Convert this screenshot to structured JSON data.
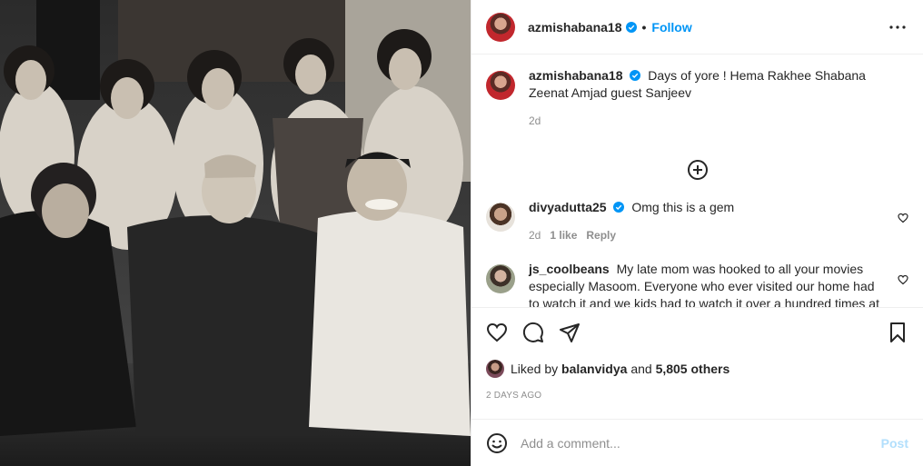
{
  "post": {
    "username": "azmishabana18",
    "follow_label": "Follow",
    "dot": "•",
    "caption": "Days of yore ! Hema Rakhee Shabana Zeenat Amjad guest Sanjeev",
    "caption_age": "2d"
  },
  "comments": [
    {
      "username": "divyadutta25",
      "text": "Omg this is a gem",
      "age": "2d",
      "likes": "1 like",
      "reply_label": "Reply"
    },
    {
      "username": "js_coolbeans",
      "text": "My late mom was hooked to all your movies especially Masoom. Everyone who ever visited our home had to watch it and we kids had to watch it over a hundred times at"
    }
  ],
  "likes": {
    "prefix": "Liked by",
    "user": "balanvidya",
    "conj": "and",
    "others": "5,805 others"
  },
  "date": "2 DAYS AGO",
  "add_comment": {
    "placeholder": "Add a comment...",
    "post_label": "Post"
  },
  "colors": {
    "accent": "#0095f6",
    "post_disabled": "#b2dffc",
    "muted": "#8e8e8e"
  },
  "icons": [
    "verified-icon",
    "more-options-icon",
    "add-circle-icon",
    "heart-icon",
    "comment-icon",
    "share-icon",
    "save-icon",
    "emoji-icon"
  ]
}
